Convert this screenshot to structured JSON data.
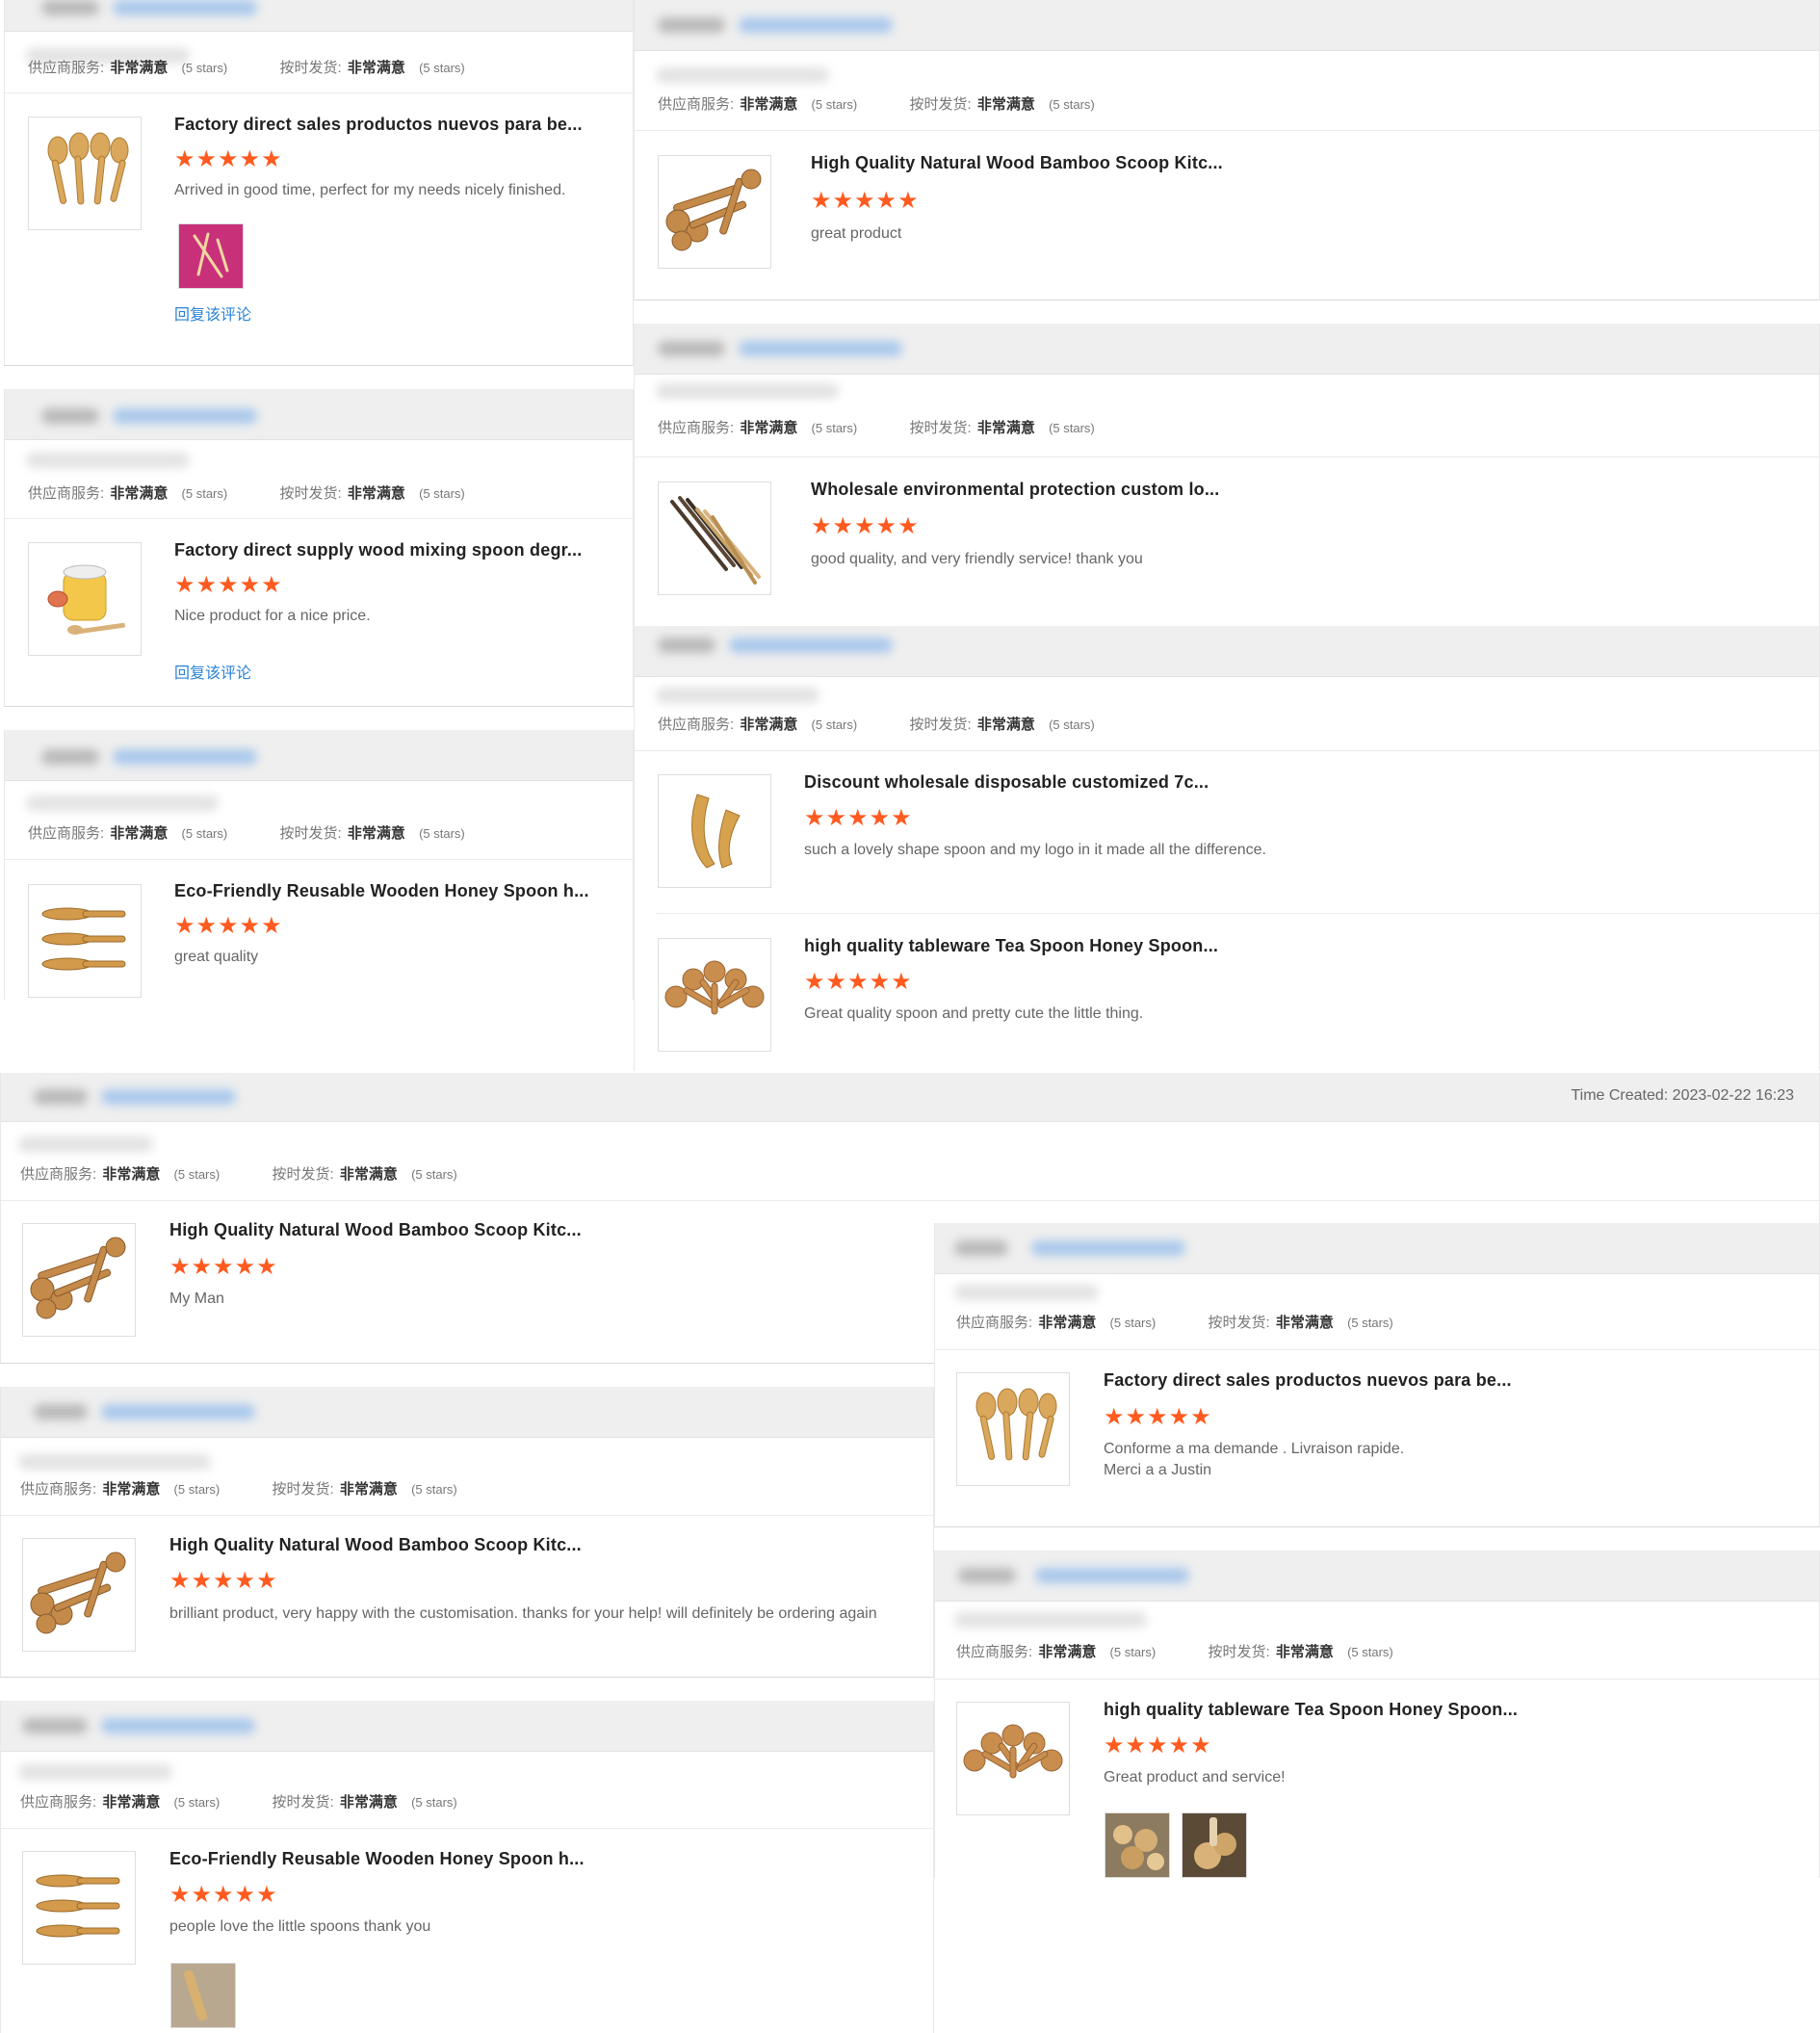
{
  "labels": {
    "supplier_service": "供应商服务:",
    "on_time_shipping": "按时发货:",
    "very_satisfied": "非常满意",
    "five_stars": "(5 stars)",
    "reply": "回复该评论"
  },
  "colors": {
    "star": "#ff5a1f",
    "reply_link": "#2a83d6",
    "header_bg": "#efefef"
  },
  "reviews": [
    {
      "title": "Factory direct sales productos nuevos para be...",
      "stars": 5,
      "comment": "Arrived in good time, perfect for my needs nicely finished.",
      "product_icon": "bamboo-spoons-icon",
      "has_photo": true,
      "has_reply": true
    },
    {
      "title": "Factory direct supply wood mixing spoon degr...",
      "stars": 5,
      "comment": "Nice product for a nice price.",
      "product_icon": "honey-jar-spoon-icon",
      "has_reply": true
    },
    {
      "title": "Eco-Friendly Reusable Wooden Honey Spoon h...",
      "stars": 5,
      "comment": "great quality",
      "product_icon": "wooden-spoons-icon"
    },
    {
      "title": "High Quality Natural Wood Bamboo Scoop Kitc...",
      "stars": 5,
      "comment": "great product",
      "product_icon": "wood-scoops-icon"
    },
    {
      "title": "Wholesale environmental protection custom lo...",
      "stars": 5,
      "comment": "good quality, and very friendly service! thank you",
      "product_icon": "chopsticks-icon"
    },
    {
      "title": "Discount wholesale disposable customized 7c...",
      "stars": 5,
      "comment": "such a lovely shape spoon and my logo in it made all the difference.",
      "product_icon": "curved-spoons-icon"
    },
    {
      "title": "high quality tableware Tea Spoon Honey Spoon...",
      "stars": 5,
      "comment": "Great quality spoon and pretty cute the little thing.",
      "product_icon": "fan-spoons-icon"
    },
    {
      "title": "High Quality Natural Wood Bamboo Scoop Kitc...",
      "stars": 5,
      "comment": "My Man",
      "product_icon": "wood-scoops-icon",
      "time_created": "Time Created: 2023-02-22 16:23"
    },
    {
      "title": "High Quality Natural Wood Bamboo Scoop Kitc...",
      "stars": 5,
      "comment": "brilliant product, very happy with the customisation. thanks for your help! will definitely be ordering again",
      "product_icon": "wood-scoops-icon"
    },
    {
      "title": "Eco-Friendly Reusable Wooden Honey Spoon h...",
      "stars": 5,
      "comment": "people love the little spoons thank you",
      "product_icon": "wooden-spoons-icon",
      "has_photo": true
    },
    {
      "title": "Factory direct sales productos nuevos para be...",
      "stars": 5,
      "comment": "Conforme a ma demande . Livraison rapide.\nMerci a a Justin",
      "product_icon": "bamboo-spoons-icon"
    },
    {
      "title": "high quality tableware Tea Spoon Honey Spoon...",
      "stars": 5,
      "comment": "Great product and service!",
      "product_icon": "fan-spoons-icon",
      "has_photo": true
    }
  ],
  "star_glyphs": "★★★★★"
}
